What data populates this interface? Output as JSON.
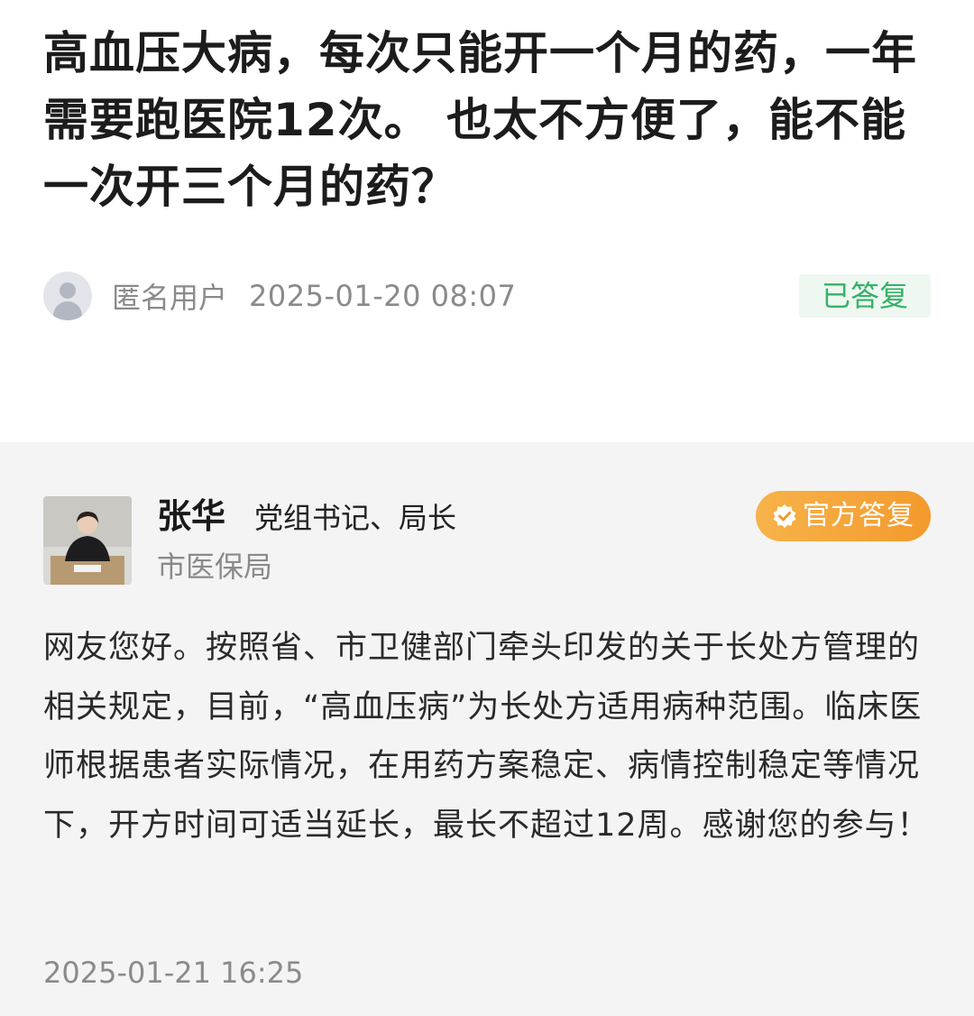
{
  "question": {
    "title": "高血压大病，每次只能开一个月的药，一年需要跑医院12次。 也太不方便了，能不能一次开三个月的药？",
    "asker_name": "匿名用户",
    "posted_time": "2025-01-20 08:07",
    "status": "已答复"
  },
  "reply": {
    "responder_name": "张华",
    "responder_title": "党组书记、局长",
    "responder_org": "市医保局",
    "badge_label": "官方答复",
    "body": "网友您好。按照省、市卫健部门牵头印发的关于长处方管理的相关规定，目前，“高血压病”为长处方适用病种范围。临床医师根据患者实际情况，在用药方案稳定、病情控制稳定等情况下，开方时间可适当延长，最长不超过12周。感谢您的参与！",
    "reply_time": "2025-01-21 16:25"
  },
  "icons": {
    "anon_avatar": "user-silhouette-icon",
    "official_badge": "check-badge-icon"
  },
  "colors": {
    "status_green": "#34b268",
    "status_bg": "#eef8f1",
    "official_orange": "#f39a2c",
    "reply_bg": "#f4f4f4"
  }
}
